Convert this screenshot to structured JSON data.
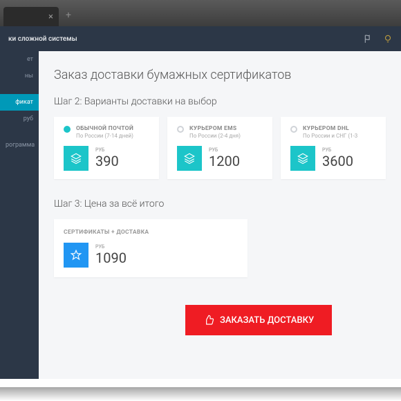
{
  "topbar": {
    "title": "ки сложной системы"
  },
  "nav": {
    "items": [
      {
        "label": "ет"
      },
      {
        "label": "ны"
      },
      {
        "label": "фикат"
      },
      {
        "label": "руб"
      },
      {
        "label": "рограмма"
      }
    ]
  },
  "page": {
    "title": "Заказ доставки бумажных сертификатов",
    "step2": "Шаг 2: Варианты доставки на выбор",
    "step3": "Шаг 3: Цена за всё итого"
  },
  "options": [
    {
      "title": "ОБЫЧНОЙ ПОЧТОЙ",
      "sub": "По России (7-14 дней)",
      "currency": "РУБ",
      "price": "390",
      "selected": true
    },
    {
      "title": "КУРЬЕРОМ EMS",
      "sub": "По России (2-4 дня)",
      "currency": "РУБ",
      "price": "1200",
      "selected": false
    },
    {
      "title": "КУРЬЕРОМ DHL",
      "sub": "По России и СНГ (1-3",
      "currency": "РУБ",
      "price": "3600",
      "selected": false
    }
  ],
  "total": {
    "label": "СЕРТИФИКАТЫ + ДОСТАВКА",
    "currency": "РУБ",
    "price": "1090"
  },
  "cta": {
    "label": "ЗАКАЗАТЬ ДОСТАВКУ"
  }
}
